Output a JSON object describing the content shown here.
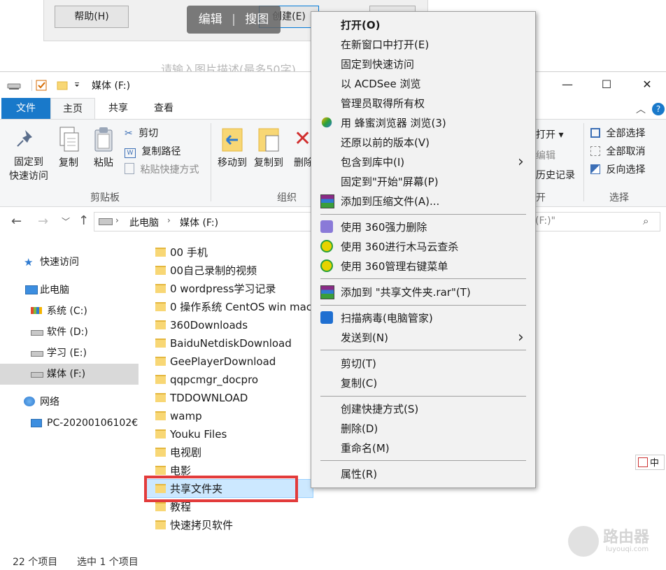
{
  "bg_dialog": {
    "help_label": "帮助(H)",
    "edit_label": "编辑",
    "crop_label": "搜图",
    "create_label": "创建(E)",
    "desc_placeholder": "请输入图片描述(最多50字)"
  },
  "window": {
    "title": "媒体 (F:)",
    "minimize": "—",
    "maximize": "☐",
    "close": "✕"
  },
  "ribbon": {
    "tabs": [
      "文件",
      "主页",
      "共享",
      "查看"
    ],
    "clipboard": {
      "pin_label": "固定到\n快速访问",
      "pin_line1": "固定到",
      "pin_line2": "快速访问",
      "copy_label": "复制",
      "paste_label": "粘贴",
      "cut_label": "剪切",
      "copy_path_label": "复制路径",
      "paste_shortcut_label": "粘贴快捷方式",
      "group_label": "剪贴板"
    },
    "organize": {
      "move_to_label": "移动到",
      "copy_to_label": "复制到",
      "delete_label": "删除",
      "group_label": "组织"
    },
    "open_group": {
      "open_label": "打开 ▾",
      "edit_label": "编辑",
      "history_label": "历史记录",
      "group_label": "开"
    },
    "select": {
      "select_all": "全部选择",
      "select_none": "全部取消",
      "invert": "反向选择",
      "group_label": "选择"
    }
  },
  "address": {
    "crumbs": [
      "此电脑",
      "媒体 (F:)"
    ],
    "search_placeholder": "(F:)\""
  },
  "navpane": {
    "items": [
      {
        "label": "快速访问",
        "icon": "star-icon"
      },
      {
        "label": "此电脑",
        "icon": "pc-icon"
      },
      {
        "label": "系统 (C:)",
        "icon": "drive-c-icon"
      },
      {
        "label": "软件 (D:)",
        "icon": "drive-icon"
      },
      {
        "label": "学习 (E:)",
        "icon": "drive-icon"
      },
      {
        "label": "媒体 (F:)",
        "icon": "drive-icon"
      },
      {
        "label": "网络",
        "icon": "network-icon"
      },
      {
        "label": "PC-20200106102€",
        "icon": "computer-icon"
      }
    ]
  },
  "files": [
    "00 手机",
    "00自己录制的视频",
    "0 wordpress学习记录",
    "0 操作系统 CentOS win mac",
    "360Downloads",
    "BaiduNetdiskDownload",
    "GeePlayerDownload",
    "qqpcmgr_docpro",
    "TDDOWNLOAD",
    "wamp",
    "Youku Files",
    "电视剧",
    "电影",
    "共享文件夹",
    "教程",
    "快速拷贝软件"
  ],
  "status": {
    "count": "22 个项目",
    "selected": "选中 1 个项目"
  },
  "context_menu": {
    "items": [
      "打开(O)",
      "在新窗口中打开(E)",
      "固定到快速访问",
      "以 ACDSee 浏览",
      "管理员取得所有权",
      "用 蜂蜜浏览器 浏览(3)",
      "还原以前的版本(V)",
      "包含到库中(I)",
      "固定到\"开始\"屏幕(P)",
      "添加到压缩文件(A)...",
      "使用 360强力删除",
      "使用 360进行木马云查杀",
      "使用 360管理右键菜单",
      "添加到 \"共享文件夹.rar\"(T)",
      "扫描病毒(电脑管家)",
      "发送到(N)",
      "剪切(T)",
      "复制(C)",
      "创建快捷方式(S)",
      "删除(D)",
      "重命名(M)",
      "属性(R)"
    ]
  },
  "right_edge": {
    "ime": "中"
  },
  "watermark": {
    "text": "路由器",
    "sub": "luyouqi.com"
  }
}
